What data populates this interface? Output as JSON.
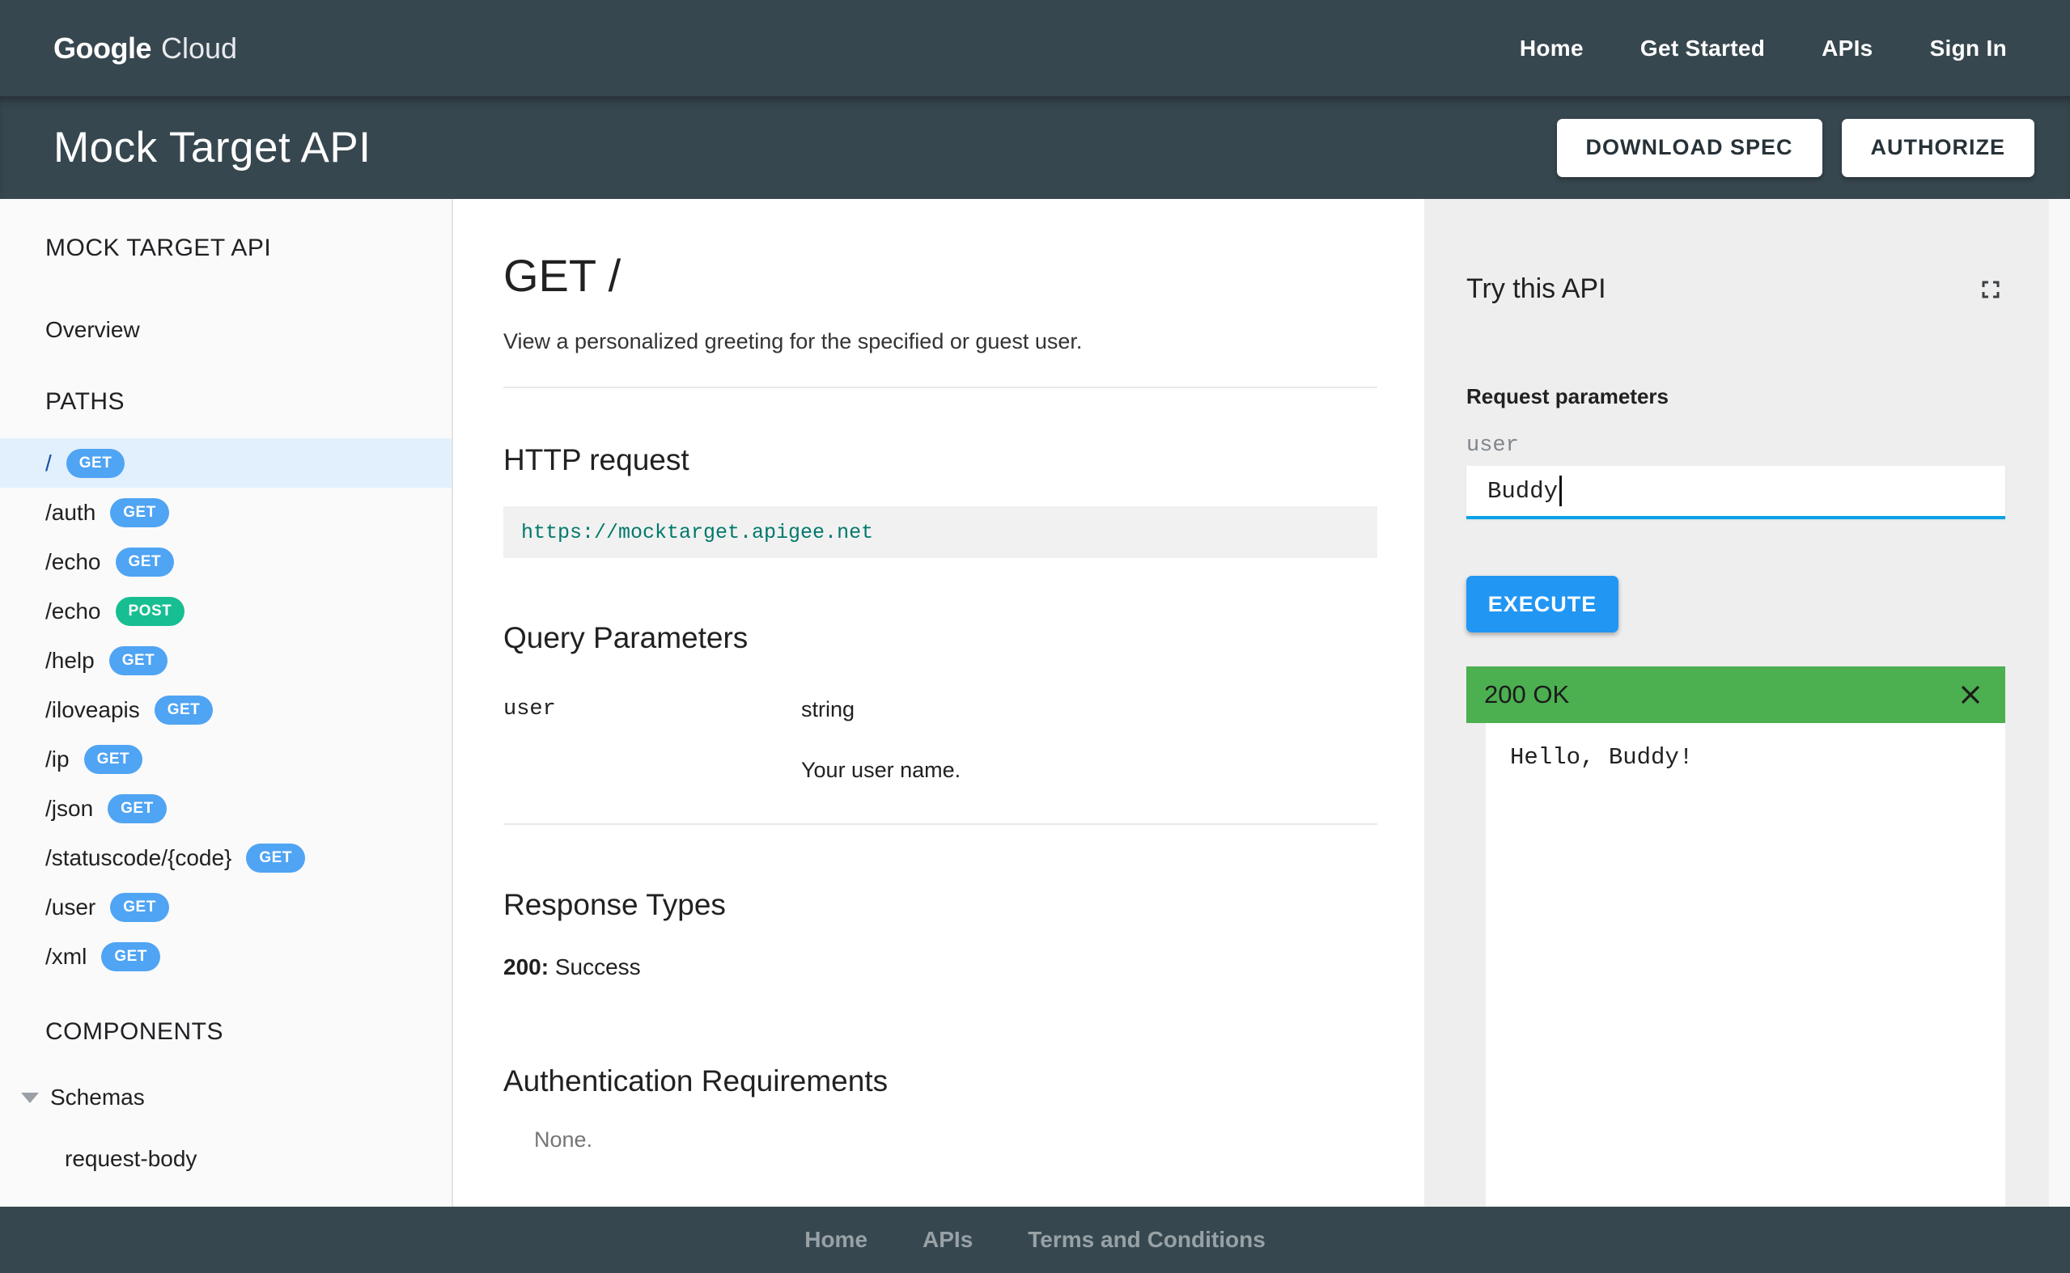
{
  "topnav": {
    "logo_primary": "Google",
    "logo_secondary": "Cloud",
    "links": [
      "Home",
      "Get Started",
      "APIs",
      "Sign In"
    ]
  },
  "titlebar": {
    "title": "Mock Target API",
    "download_label": "DOWNLOAD SPEC",
    "authorize_label": "AUTHORIZE"
  },
  "sidebar": {
    "api_title": "MOCK TARGET API",
    "overview_label": "Overview",
    "paths_heading": "PATHS",
    "paths": [
      {
        "path": "/",
        "method": "GET",
        "selected": true
      },
      {
        "path": "/auth",
        "method": "GET"
      },
      {
        "path": "/echo",
        "method": "GET"
      },
      {
        "path": "/echo",
        "method": "POST"
      },
      {
        "path": "/help",
        "method": "GET"
      },
      {
        "path": "/iloveapis",
        "method": "GET"
      },
      {
        "path": "/ip",
        "method": "GET"
      },
      {
        "path": "/json",
        "method": "GET"
      },
      {
        "path": "/statuscode/{code}",
        "method": "GET"
      },
      {
        "path": "/user",
        "method": "GET"
      },
      {
        "path": "/xml",
        "method": "GET"
      }
    ],
    "components_heading": "COMPONENTS",
    "schemas_label": "Schemas",
    "schema_items": [
      "request-body"
    ]
  },
  "main": {
    "title": "GET /",
    "description": "View a personalized greeting for the specified or guest user.",
    "http_request": {
      "heading": "HTTP request",
      "url": "https://mocktarget.apigee.net"
    },
    "query_parameters": {
      "heading": "Query Parameters",
      "rows": [
        {
          "name": "user",
          "type": "string",
          "description": "Your user name."
        }
      ]
    },
    "response_types": {
      "heading": "Response Types",
      "code": "200:",
      "label": "Success"
    },
    "auth": {
      "heading": "Authentication Requirements",
      "value": "None."
    }
  },
  "try_panel": {
    "heading": "Try this API",
    "request_parameters_label": "Request parameters",
    "param_name": "user",
    "param_value": "Buddy",
    "execute_label": "EXECUTE",
    "response_status": "200 OK",
    "response_body": "Hello, Buddy!"
  },
  "footer": {
    "links": [
      "Home",
      "APIs",
      "Terms and Conditions"
    ]
  },
  "colors": {
    "header_bg": "#37474F",
    "get_badge": "#4FA4F3",
    "post_badge": "#17BE92",
    "selected_item_bg": "#E1F0FC",
    "selected_item_text": "#174EA6",
    "execute_button": "#2196F3",
    "input_underline": "#0AA2E8",
    "success_bar": "#4CAF50",
    "code_url_text": "#00796B"
  }
}
